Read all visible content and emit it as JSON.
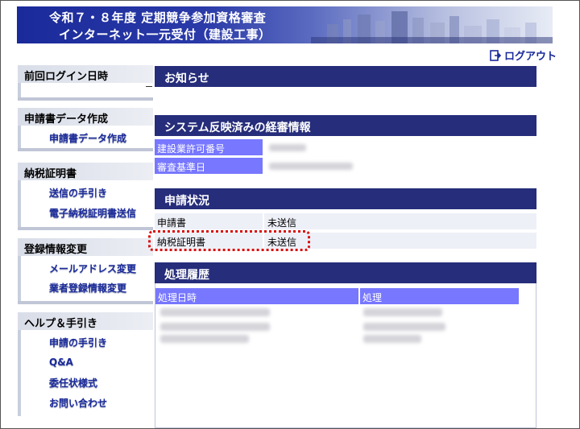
{
  "header": {
    "title_line1": "令和７・８年度 定期競争参加資格審査",
    "title_line2": "インターネット一元受付（建設工事）"
  },
  "logout": {
    "label": "ログアウト",
    "icon": "logout-icon"
  },
  "sidebar": {
    "sections": [
      {
        "title": "前回ログイン日時",
        "items": []
      },
      {
        "title": "申請書データ作成",
        "items": [
          "申請書データ作成"
        ]
      },
      {
        "title": "納税証明書",
        "items": [
          "送信の手引き",
          "電子納税証明書送信"
        ]
      },
      {
        "title": "登録情報変更",
        "items": [
          "メールアドレス変更",
          "業者登録情報変更"
        ]
      },
      {
        "title": "ヘルプ＆手引き",
        "items": [
          "申請の手引き",
          "Q&A",
          "委任状様式",
          "お問い合わせ"
        ]
      }
    ]
  },
  "notice": {
    "title": "お知らせ"
  },
  "keishin": {
    "title": "システム反映済みの経審情報",
    "rows": [
      {
        "label": "建設業許可番号"
      },
      {
        "label": "審査基準日"
      }
    ]
  },
  "status": {
    "title": "申請状況",
    "rows": [
      {
        "label": "申請書",
        "value": "未送信"
      },
      {
        "label": "納税証明書",
        "value": "未送信"
      }
    ]
  },
  "history": {
    "title": "処理履歴",
    "columns": [
      "処理日時",
      "処理"
    ]
  },
  "colors": {
    "header_navy": "#262d7a",
    "label_blue": "#7777ff",
    "link_blue": "#1a2a9a",
    "highlight_red": "#d81010"
  }
}
